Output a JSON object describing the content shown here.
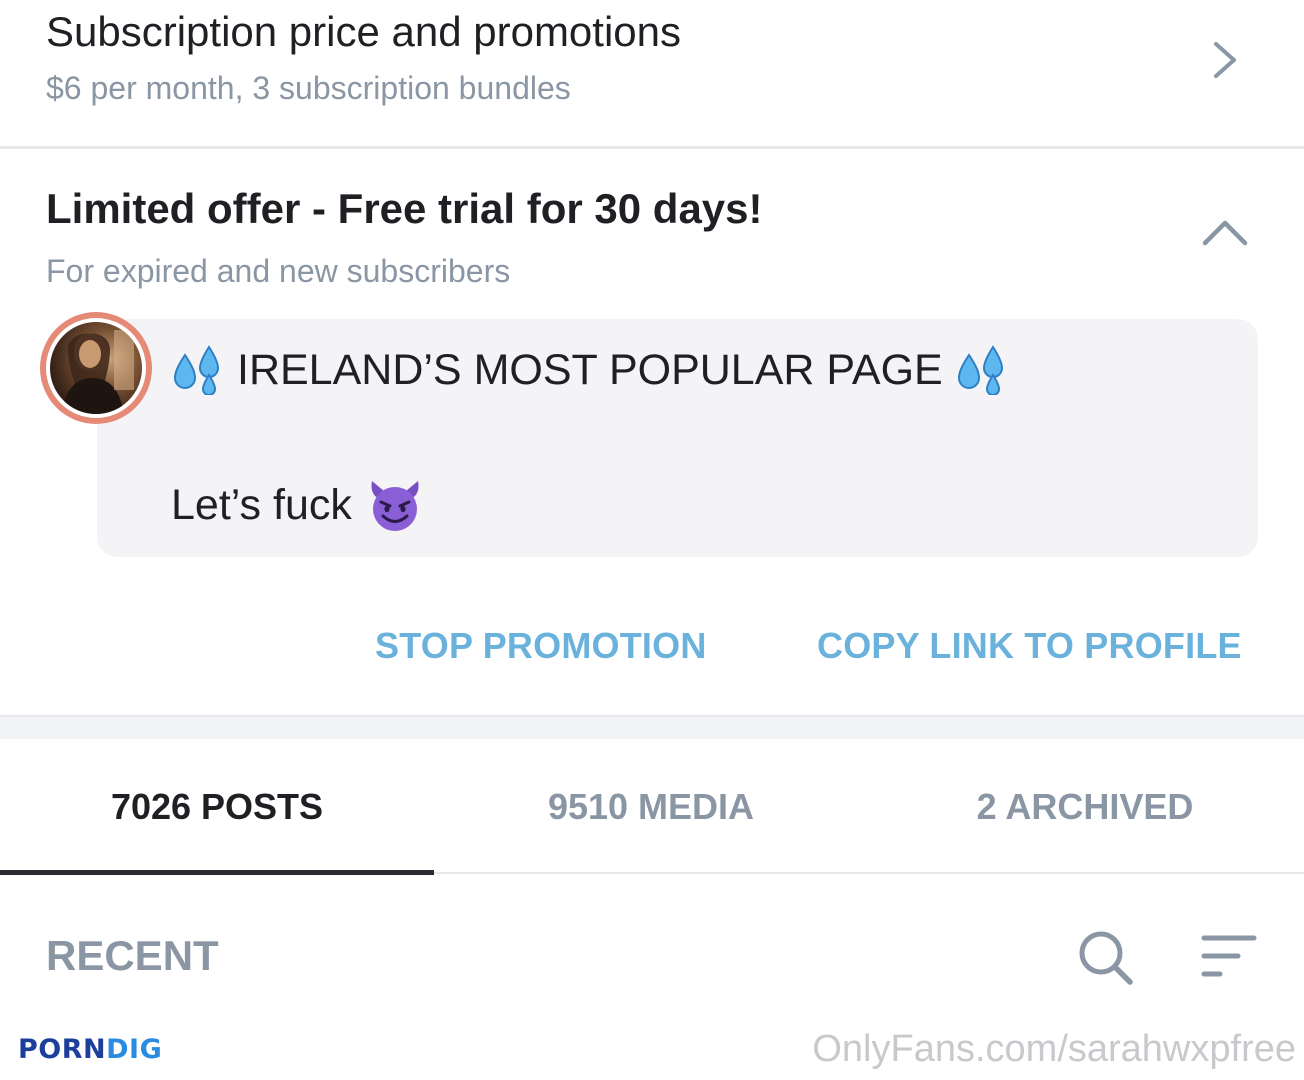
{
  "subscription_row": {
    "title": "Subscription price and promotions",
    "subtitle": "$6 per month, 3 subscription bundles",
    "icon": "chevron-right-icon"
  },
  "promotion": {
    "title": "Limited offer - Free trial for 30 days!",
    "subtitle": "For expired and new subscribers",
    "collapse_icon": "chevron-up-icon",
    "message": {
      "line1": "IRELAND’S MOST POPULAR PAGE",
      "line1_icon": "sweat-droplets-emoji",
      "line2": "Let’s fuck",
      "line2_icon": "smiling-devil-emoji"
    },
    "actions": {
      "stop": "STOP PROMOTION",
      "copy": "COPY LINK TO PROFILE"
    }
  },
  "tabs": [
    {
      "label": "7026 POSTS",
      "active": true
    },
    {
      "label": "9510 MEDIA",
      "active": false
    },
    {
      "label": "2 ARCHIVED",
      "active": false
    }
  ],
  "filter": {
    "label": "RECENT",
    "search_icon": "search-icon",
    "sort_icon": "sort-icon"
  },
  "watermark": {
    "left_part1": "PORN",
    "left_part2": "DIG",
    "right": "OnlyFans.com/sarahwxpfree"
  },
  "colors": {
    "accent": "#6ab2dc",
    "muted_text": "#8a96a3",
    "primary_text": "#1f1f24",
    "bubble_bg": "#f4f4f7",
    "avatar_ring": "#e58a76",
    "watermark_porn": "#1d3f9c",
    "watermark_dig": "#2a8ce0"
  }
}
